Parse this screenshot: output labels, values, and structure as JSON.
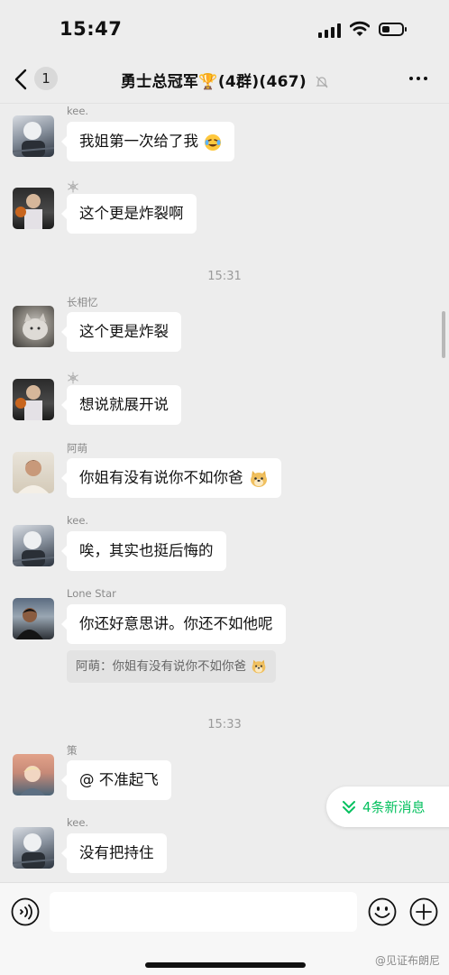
{
  "status_bar": {
    "time": "15:47"
  },
  "nav": {
    "back_badge": "1",
    "title": "勇士总冠军🏆(4群)(467)"
  },
  "messages": [
    {
      "sender": "kee.",
      "text": "我姐第一次给了我",
      "emoji": "crying-laughing-emoji"
    },
    {
      "sender": "",
      "sender_icon": "snowflake-icon",
      "text": "这个更是炸裂啊"
    },
    {
      "sender": "长相忆",
      "text": "这个更是炸裂"
    },
    {
      "sender": "",
      "sender_icon": "snowflake-icon",
      "text": "想说就展开说"
    },
    {
      "sender": "阿萌",
      "text": "你姐有没有说你不如你爸",
      "emoji": "doge-emoji"
    },
    {
      "sender": "kee.",
      "text": "唉，其实也挺后悔的"
    },
    {
      "sender": "Lone Star",
      "text": "你还好意思讲。你还不如他呢",
      "quote": "阿萌：你姐有没有说你不如你爸",
      "quote_emoji": "doge-emoji"
    },
    {
      "sender": "策",
      "text": "@ 不准起飞"
    },
    {
      "sender": "kee.",
      "text": "没有把持住"
    }
  ],
  "timestamps": [
    "15:31",
    "15:33"
  ],
  "new_messages": {
    "label": "4条新消息"
  },
  "input": {
    "placeholder": ""
  },
  "watermark": "@见证布朗尼",
  "colors": {
    "accent": "#07c160",
    "background": "#ededed",
    "bubble": "#ffffff"
  }
}
